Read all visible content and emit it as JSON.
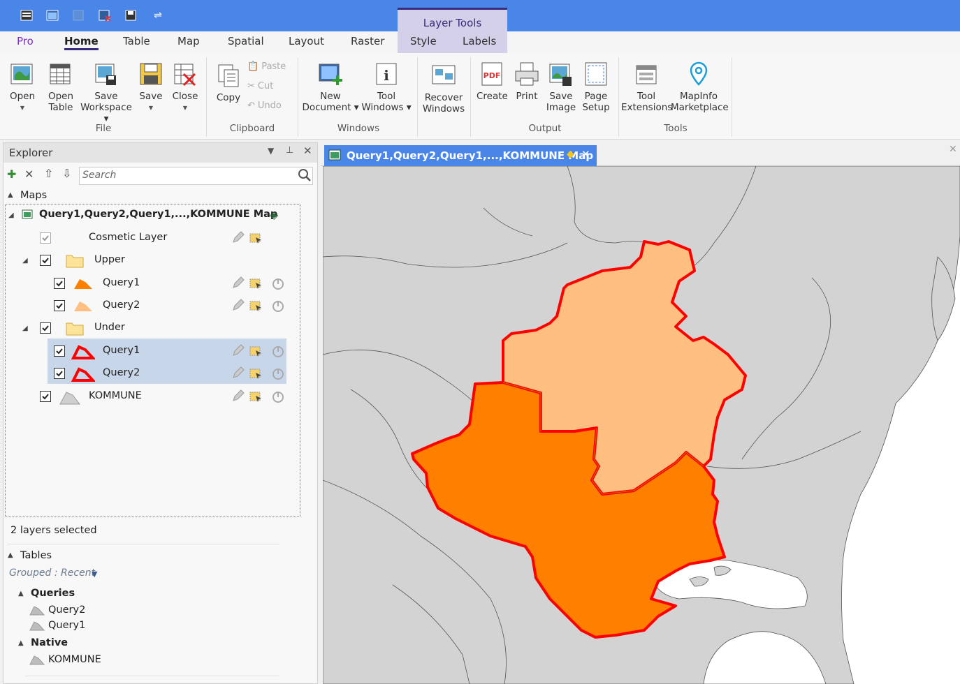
{
  "quick_access": [
    "app-menu-icon",
    "open-map-icon",
    "new-doc-icon",
    "close-table-icon",
    "save-icon",
    "customize-icon"
  ],
  "context_tab_group": "Layer Tools",
  "tabs": {
    "pro": "Pro",
    "home": "Home",
    "table": "Table",
    "map": "Map",
    "spatial": "Spatial",
    "layout": "Layout",
    "raster": "Raster",
    "style": "Style",
    "labels": "Labels"
  },
  "ribbon": {
    "file": {
      "group": "File",
      "open": "Open",
      "open_table_1": "Open",
      "open_table_2": "Table",
      "save_ws_1": "Save",
      "save_ws_2": "Workspace",
      "save": "Save",
      "close": "Close"
    },
    "clipboard": {
      "group": "Clipboard",
      "copy": "Copy",
      "paste": "Paste",
      "cut": "Cut",
      "undo": "Undo"
    },
    "windows": {
      "group": "Windows",
      "new_doc_1": "New",
      "new_doc_2": "Document",
      "tool_win_1": "Tool",
      "tool_win_2": "Windows",
      "recover_1": "Recover",
      "recover_2": "Windows"
    },
    "output": {
      "group": "Output",
      "create": "Create",
      "print": "Print",
      "save_img_1": "Save",
      "save_img_2": "Image",
      "page_setup_1": "Page",
      "page_setup_2": "Setup"
    },
    "tools": {
      "group": "Tools",
      "tool_ext_1": "Tool",
      "tool_ext_2": "Extensions",
      "marketplace_1": "MapInfo",
      "marketplace_2": "Marketplace"
    }
  },
  "explorer": {
    "title": "Explorer",
    "search_placeholder": "Search",
    "maps_header": "Maps",
    "map_name": "Query1,Query2,Query1,...,KOMMUNE Map",
    "layers": {
      "cosmetic": "Cosmetic Layer",
      "upper": "Upper",
      "upper_q1": "Query1",
      "upper_q2": "Query2",
      "under": "Under",
      "under_q1": "Query1",
      "under_q2": "Query2",
      "kommune": "KOMMUNE"
    },
    "status": "2 layers selected",
    "tables_header": "Tables",
    "grouped": "Grouped : Recent",
    "queries_header": "Queries",
    "queries": [
      "Query2",
      "Query1"
    ],
    "native_header": "Native",
    "native": [
      "KOMMUNE"
    ]
  },
  "map_tab": {
    "title": "Query1,Query2,Query1,...,KOMMUNE Map"
  },
  "colors": {
    "titlebar": "#4a86e8",
    "context": "#d5d0ea",
    "dark_orange": "#ff7f00",
    "light_orange": "#ffbf80",
    "outline": "#ff0000",
    "land": "#d3d3d3",
    "sea": "#ffffff"
  }
}
